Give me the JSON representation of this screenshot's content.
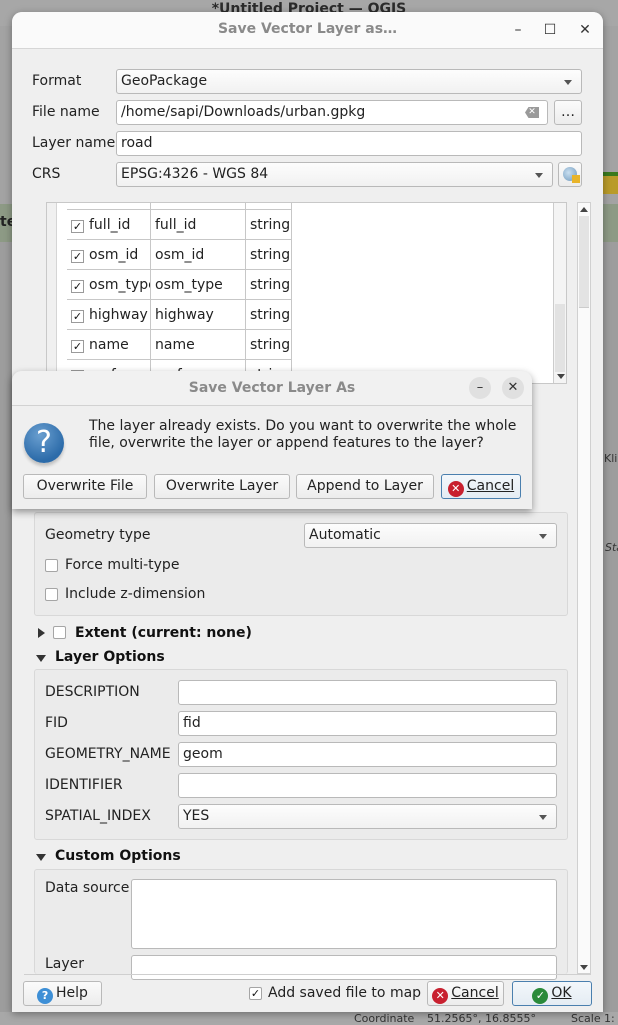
{
  "background": {
    "app_title": "*Untitled Project — QGIS",
    "partial_label": "te",
    "map_labels": [
      "Klic",
      "Sta"
    ],
    "status": {
      "coordinate_label": "Coordinate",
      "coordinate_value": "51.2565°, 16.8555°",
      "scale_label": "Scale",
      "scale_value": "1:"
    }
  },
  "dialog": {
    "title": "Save Vector Layer as…",
    "window_buttons": {
      "minimize": "–",
      "maximize": "☐",
      "close": "✕"
    },
    "format": {
      "label": "Format",
      "value": "GeoPackage"
    },
    "file_name": {
      "label": "File name",
      "value": "/home/sapi/Downloads/urban.gpkg",
      "browse_label": "…"
    },
    "layer_name": {
      "label": "Layer name",
      "value": "road"
    },
    "crs": {
      "label": "CRS",
      "value": "EPSG:4326 - WGS 84"
    },
    "fields": [
      {
        "checked": true,
        "name": "full_id",
        "export_name": "full_id",
        "type": "string"
      },
      {
        "checked": true,
        "name": "osm_id",
        "export_name": "osm_id",
        "type": "string"
      },
      {
        "checked": true,
        "name": "osm_type",
        "export_name": "osm_type",
        "type": "string"
      },
      {
        "checked": true,
        "name": "highway",
        "export_name": "highway",
        "type": "string"
      },
      {
        "checked": true,
        "name": "name",
        "export_name": "name",
        "type": "string"
      },
      {
        "checked": true,
        "name": "surface",
        "export_name": "surface",
        "type": "string"
      }
    ],
    "geometry": {
      "type_label": "Geometry type",
      "type_value": "Automatic",
      "force_multi_label": "Force multi-type",
      "force_multi_checked": false,
      "include_z_label": "Include z-dimension",
      "include_z_checked": false
    },
    "extent": {
      "label": "Extent (current: none)",
      "checked": false,
      "expanded": false
    },
    "layer_options": {
      "title": "Layer Options",
      "items": [
        {
          "label": "DESCRIPTION",
          "value": ""
        },
        {
          "label": "FID",
          "value": "fid"
        },
        {
          "label": "GEOMETRY_NAME",
          "value": "geom"
        },
        {
          "label": "IDENTIFIER",
          "value": ""
        },
        {
          "label": "SPATIAL_INDEX",
          "value": "YES"
        }
      ]
    },
    "custom_options": {
      "title": "Custom Options",
      "data_source_label": "Data source",
      "data_source_value": "",
      "layer_label": "Layer",
      "layer_value": ""
    },
    "footer": {
      "help_label": "Help",
      "add_to_map_label": "Add saved file to map",
      "add_to_map_checked": true,
      "cancel_label": "Cancel",
      "ok_label": "OK"
    }
  },
  "message_box": {
    "title": "Save Vector Layer As",
    "text": "The layer already exists. Do you want to overwrite the whole file, overwrite the layer or append features to the layer?",
    "buttons": {
      "overwrite_file": "Overwrite File",
      "overwrite_layer": "Overwrite Layer",
      "append_to_layer": "Append to Layer",
      "cancel": "Cancel"
    },
    "window_buttons": {
      "minimize": "–",
      "close": "✕"
    }
  },
  "colors": {
    "cancel_icon": "#c8202f",
    "ok_icon": "#2a8a3a",
    "help_icon": "#3d8fd6",
    "question_icon": "#2c6ba9",
    "default_button_border": "#4a7fae"
  }
}
